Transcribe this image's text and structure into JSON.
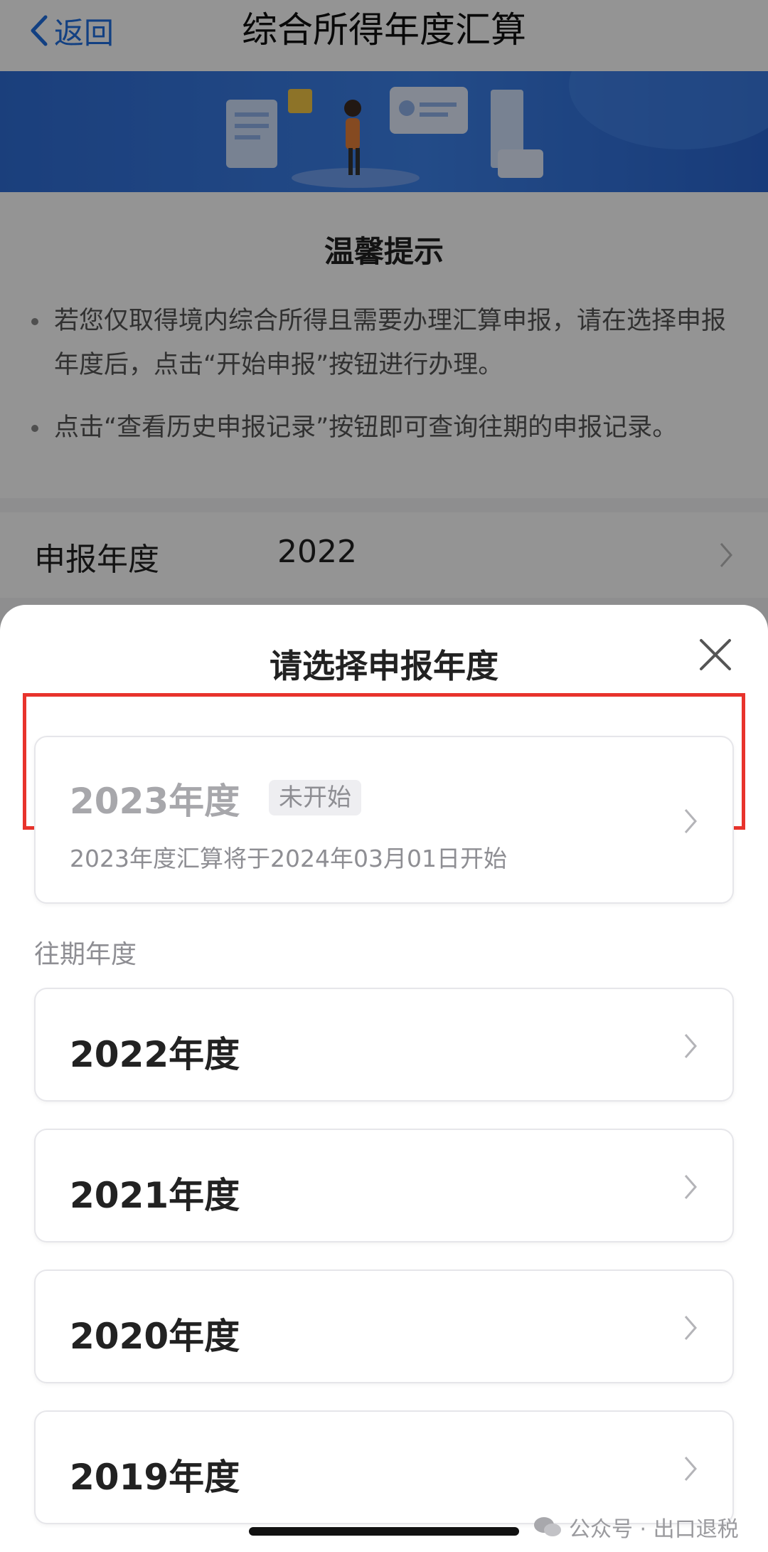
{
  "nav": {
    "back_label": "返回",
    "title": "综合所得年度汇算"
  },
  "tips": {
    "title": "温馨提示",
    "items": [
      "若您仅取得境内综合所得且需要办理汇算申报，请在选择申报年度后，点击“开始申报”按钮进行办理。",
      "点击“查看历史申报记录”按钮即可查询往期的申报记录。"
    ]
  },
  "year_row": {
    "label": "申报年度",
    "value": "2022"
  },
  "sheet": {
    "title": "请选择申报年度",
    "current": {
      "title": "2023年度",
      "badge": "未开始",
      "subtitle": "2023年度汇算将于2024年03月01日开始"
    },
    "past_label": "往期年度",
    "past_years": [
      "2022年度",
      "2021年度",
      "2020年度",
      "2019年度"
    ]
  },
  "watermark": "公众号 · 出口退税",
  "colors": {
    "accent": "#1f6fe0",
    "highlight_border": "#e8332c",
    "banner": "#3a7be6",
    "muted_text": "#8e8e93"
  },
  "icons": [
    "chevron-left-icon",
    "close-icon",
    "chevron-right-icon",
    "wechat-icon"
  ]
}
